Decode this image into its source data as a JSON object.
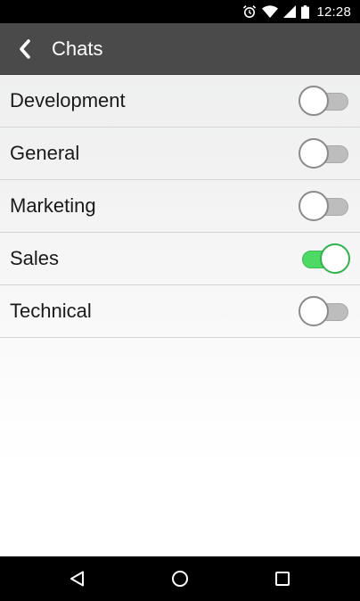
{
  "status_bar": {
    "time": "12:28",
    "icons": [
      "alarm-icon",
      "wifi-icon",
      "signal-icon",
      "battery-icon"
    ]
  },
  "app_bar": {
    "title": "Chats",
    "back_icon": "chevron-left-icon"
  },
  "list": {
    "items": [
      {
        "label": "Development",
        "enabled": false
      },
      {
        "label": "General",
        "enabled": false
      },
      {
        "label": "Marketing",
        "enabled": false
      },
      {
        "label": "Sales",
        "enabled": true
      },
      {
        "label": "Technical",
        "enabled": false
      }
    ]
  },
  "nav_bar": {
    "icons": [
      "back-triangle-icon",
      "home-circle-icon",
      "recents-square-icon"
    ]
  },
  "colors": {
    "app_bar": "#4a4a4a",
    "toggle_on": "#4cd964",
    "toggle_off": "#bdbdbd"
  }
}
